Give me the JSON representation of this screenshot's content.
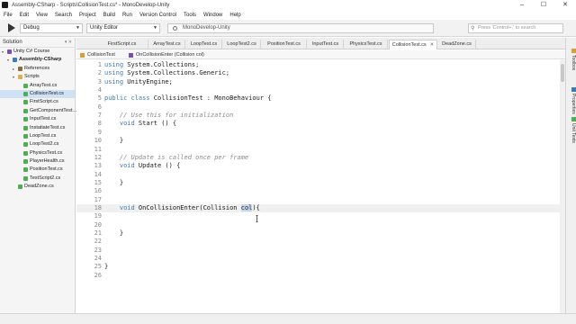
{
  "window": {
    "title": "Assembly-CSharp - Scripts\\CollisionTest.cs* - MonoDevelop-Unity",
    "controls": [
      "–",
      "☐",
      "✕"
    ]
  },
  "menu": [
    "File",
    "Edit",
    "View",
    "Search",
    "Project",
    "Build",
    "Run",
    "Version Control",
    "Tools",
    "Window",
    "Help"
  ],
  "toolbar": {
    "config": "Debug",
    "target": "Unity Editor",
    "status": "MonoDevelop-Unity",
    "search_placeholder": "Press 'Control+,' to search"
  },
  "solution": {
    "header": "Solution",
    "items": [
      {
        "label": "Unity C# Course",
        "indent": 1,
        "icon": "solution-icon",
        "color": "#7a4fb0",
        "expander": "▾"
      },
      {
        "label": "Assembly-CSharp",
        "indent": 2,
        "icon": "project-icon",
        "color": "#3b7bbd",
        "expander": "▾",
        "bold": true
      },
      {
        "label": "References",
        "indent": 3,
        "icon": "references-icon",
        "color": "#8a6d3b",
        "expander": "▸"
      },
      {
        "label": "Scripts",
        "indent": 3,
        "icon": "folder-icon",
        "color": "#d8b04c",
        "expander": "▾"
      },
      {
        "label": "ArrayTest.cs",
        "indent": 4,
        "icon": "csharp-file-icon",
        "color": "#4caf50"
      },
      {
        "label": "CollisionTest.cs",
        "indent": 4,
        "icon": "csharp-file-icon",
        "color": "#4caf50",
        "selected": true
      },
      {
        "label": "FirstScript.cs",
        "indent": 4,
        "icon": "csharp-file-icon",
        "color": "#4caf50"
      },
      {
        "label": "GetComponentTest...",
        "indent": 4,
        "icon": "csharp-file-icon",
        "color": "#4caf50"
      },
      {
        "label": "InputTest.cs",
        "indent": 4,
        "icon": "csharp-file-icon",
        "color": "#4caf50"
      },
      {
        "label": "InstatiateTest.cs",
        "indent": 4,
        "icon": "csharp-file-icon",
        "color": "#4caf50"
      },
      {
        "label": "LoopTest.cs",
        "indent": 4,
        "icon": "csharp-file-icon",
        "color": "#4caf50"
      },
      {
        "label": "LoopTest2.cs",
        "indent": 4,
        "icon": "csharp-file-icon",
        "color": "#4caf50"
      },
      {
        "label": "PhysicsTest.cs",
        "indent": 4,
        "icon": "csharp-file-icon",
        "color": "#4caf50"
      },
      {
        "label": "PlayerHealth.cs",
        "indent": 4,
        "icon": "csharp-file-icon",
        "color": "#4caf50"
      },
      {
        "label": "PositionTest.cs",
        "indent": 4,
        "icon": "csharp-file-icon",
        "color": "#4caf50"
      },
      {
        "label": "TestScript2.cs",
        "indent": 4,
        "icon": "csharp-file-icon",
        "color": "#4caf50"
      },
      {
        "label": "DeadZone.cs",
        "indent": 3,
        "icon": "csharp-file-icon",
        "color": "#4caf50"
      }
    ]
  },
  "tabs": [
    {
      "label": "FirstScript.cs"
    },
    {
      "label": "ArrayTest.cs"
    },
    {
      "label": "LoopTest.cs"
    },
    {
      "label": "LoopTest2.cs"
    },
    {
      "label": "PositionTest.cs"
    },
    {
      "label": "InputTest.cs"
    },
    {
      "label": "PhysicsTest.cs"
    },
    {
      "label": "CollisionTest.cs",
      "active": true,
      "close": "✕"
    },
    {
      "label": "DeadZone.cs"
    }
  ],
  "breadcrumb": {
    "class": "CollisionTest",
    "method": "OnCollisionEnter (Collision col)"
  },
  "code": [
    {
      "n": "1",
      "parts": [
        [
          "kw",
          "using"
        ],
        [
          "t",
          " System.Collections;"
        ]
      ]
    },
    {
      "n": "2",
      "parts": [
        [
          "kw",
          "using"
        ],
        [
          "t",
          " System.Collections.Generic;"
        ]
      ]
    },
    {
      "n": "3",
      "parts": [
        [
          "kw",
          "using"
        ],
        [
          "t",
          " UnityEngine;"
        ]
      ]
    },
    {
      "n": "4",
      "parts": []
    },
    {
      "n": "5",
      "parts": [
        [
          "kw",
          "public class"
        ],
        [
          "t",
          " CollisionTest : MonoBehaviour {"
        ]
      ],
      "fold": "⊟"
    },
    {
      "n": "6",
      "parts": []
    },
    {
      "n": "7",
      "parts": [
        [
          "t",
          "    "
        ],
        [
          "cm",
          "// Use this for initialization"
        ]
      ],
      "fold": "⊟"
    },
    {
      "n": "8",
      "parts": [
        [
          "t",
          "    "
        ],
        [
          "kw",
          "void"
        ],
        [
          "t",
          " Start () {"
        ]
      ]
    },
    {
      "n": "9",
      "parts": []
    },
    {
      "n": "10",
      "parts": [
        [
          "t",
          "    }"
        ]
      ]
    },
    {
      "n": "11",
      "parts": []
    },
    {
      "n": "12",
      "parts": [
        [
          "t",
          "    "
        ],
        [
          "cm",
          "// Update is called once per frame"
        ]
      ],
      "fold": "⊟"
    },
    {
      "n": "13",
      "parts": [
        [
          "t",
          "    "
        ],
        [
          "kw",
          "void"
        ],
        [
          "t",
          " Update () {"
        ]
      ]
    },
    {
      "n": "14",
      "parts": []
    },
    {
      "n": "15",
      "parts": [
        [
          "t",
          "    }"
        ]
      ]
    },
    {
      "n": "16",
      "parts": []
    },
    {
      "n": "17",
      "parts": []
    },
    {
      "n": "18",
      "parts": [
        [
          "t",
          "    "
        ],
        [
          "kw",
          "void"
        ],
        [
          "t",
          " OnCollisionEnter(Collision "
        ],
        [
          "hl",
          "col"
        ],
        [
          "t",
          "){"
        ]
      ],
      "current": true,
      "fold": "⊟"
    },
    {
      "n": "19",
      "parts": []
    },
    {
      "n": "20",
      "parts": []
    },
    {
      "n": "21",
      "parts": [
        [
          "t",
          "    }"
        ]
      ]
    },
    {
      "n": "22",
      "parts": []
    },
    {
      "n": "23",
      "parts": []
    },
    {
      "n": "24",
      "parts": []
    },
    {
      "n": "25",
      "parts": [
        [
          "t",
          "}"
        ]
      ]
    },
    {
      "n": "26",
      "parts": []
    }
  ],
  "right_dock": [
    {
      "label": "Toolbox",
      "icon": "toolbox-icon"
    },
    {
      "label": "Properties",
      "icon": "properties-icon"
    },
    {
      "label": "Unit Tests",
      "icon": "unit-tests-icon"
    }
  ],
  "colors": {
    "keyword": "#3b7bbd",
    "comment": "#8c8c8c",
    "selection": "#c6d7f0"
  }
}
